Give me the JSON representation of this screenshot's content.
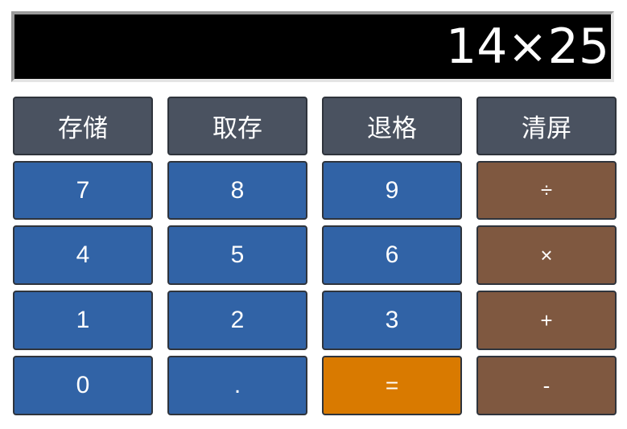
{
  "display": {
    "value": "14×25"
  },
  "keys": {
    "store": "存储",
    "recall": "取存",
    "backspace": "退格",
    "clear": "清屏",
    "n7": "7",
    "n8": "8",
    "n9": "9",
    "divide": "÷",
    "n4": "4",
    "n5": "5",
    "n6": "6",
    "multiply": "×",
    "n1": "1",
    "n2": "2",
    "n3": "3",
    "plus": "+",
    "n0": "0",
    "dot": ".",
    "equals": "=",
    "minus": "-"
  },
  "colors": {
    "display_bg": "#000000",
    "function_key": "#4a5260",
    "number_key": "#3163a6",
    "operator_key": "#7f5840",
    "equals_key": "#d97a00"
  }
}
